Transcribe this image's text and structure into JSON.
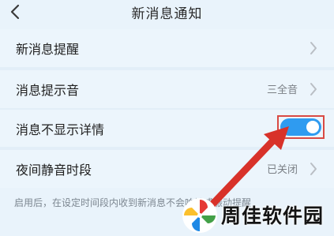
{
  "header": {
    "title": "新消息通知"
  },
  "settings": [
    {
      "label": "新消息提醒",
      "value": ""
    },
    {
      "label": "消息提示音",
      "value": "三全音"
    },
    {
      "label": "消息不显示详情",
      "value": ""
    },
    {
      "label": "夜间静音时段",
      "value": "已关闭"
    }
  ],
  "toggle": {
    "state": "on"
  },
  "footnote": "启用后，在设定时间段内收到新消息不会响铃或振动提醒",
  "watermark": {
    "text": "周佳软件园"
  },
  "colors": {
    "accent": "#2f9bf0",
    "highlight": "#d94a44",
    "background": "#e9f3fb"
  }
}
